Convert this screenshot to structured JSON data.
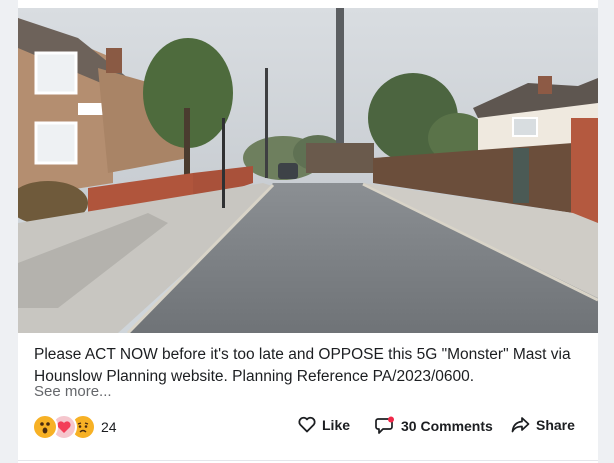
{
  "post": {
    "caption": "Please ACT NOW before it's too late and OPPOSE this 5G \"Monster\" Mast via Hounslow Planning website. Planning Reference PA/2023/0600.",
    "see_more": "See more..."
  },
  "reactions": {
    "icons": [
      "wow-emoji-icon",
      "love-heart-icon",
      "sad-emoji-icon"
    ],
    "count": "24"
  },
  "actions": {
    "like_label": "Like",
    "comments_label": "30 Comments",
    "share_label": "Share"
  },
  "colors": {
    "text": "#1c1e21",
    "muted": "#65676b",
    "love": "#f33e58",
    "reaction_yellow": "#f7b125"
  }
}
